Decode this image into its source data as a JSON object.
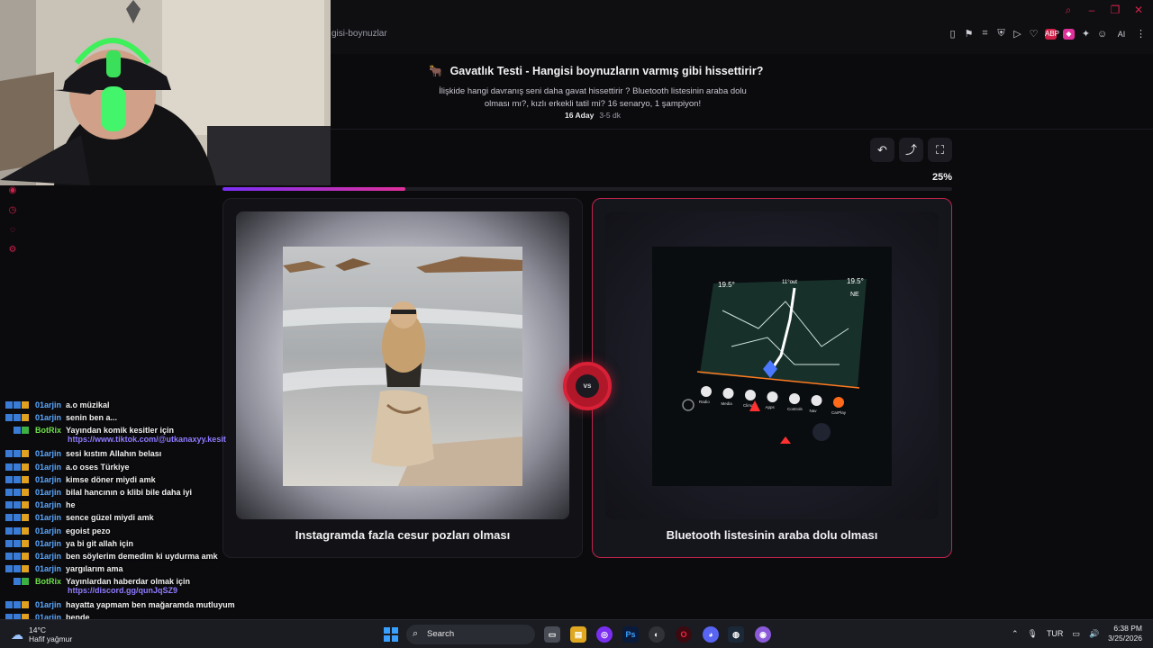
{
  "browser": {
    "url_fragment": "gisi-boynuzlar",
    "window_controls": [
      "search-icon",
      "minimize-icon",
      "restore-icon",
      "close-icon"
    ],
    "toolbar": {
      "ext_red_label": "ABP",
      "ai_label": "AI"
    }
  },
  "quiz": {
    "emoji": "🐂",
    "title": "Gavatlık Testi - Hangisi boynuzların varmış gibi hissettirir?",
    "description": "İlişkide hangi davranış seni daha gavat hissettirir ? Bluetooth listesinin araba dolu olması mı?, kızlı erkekli tatil mi? 16 senaryo, 1 şampiyon!",
    "candidates": "16 Aday",
    "duration": "3-5 dk",
    "progress_label": "25%",
    "progress_value": 0.25
  },
  "actions": {
    "back_icon": "↶",
    "share_icon": "⤴",
    "fullscreen_icon": "⛶"
  },
  "cards": {
    "left_caption": "Instagramda fazla cesur pozları olması",
    "right_caption": "Bluetooth listesinin araba dolu olması",
    "vs_label": "vs"
  },
  "car_screen": {
    "temp_left": "19.5°",
    "time": "11°out",
    "temp_right": "19.5°",
    "compass": "NE",
    "buttons": [
      "Radio",
      "Media",
      "Climate",
      "Apps",
      "Controls",
      "Nav",
      "CarPlay"
    ]
  },
  "chat": [
    {
      "user": "01arjin",
      "msg": "a.o müzikal",
      "bot": false
    },
    {
      "user": "01arjin",
      "msg": "senin ben a...",
      "bot": false
    },
    {
      "user": "BotRix",
      "msg": "Yayından komik kesitler için",
      "link": "https://www.tiktok.com/@utkanaxyy.kesit",
      "bot": true
    },
    {
      "user": "01arjin",
      "msg": "sesi kıstım Allahın belası",
      "bot": false
    },
    {
      "user": "01arjin",
      "msg": "a.o oses Türkiye",
      "bot": false
    },
    {
      "user": "01arjin",
      "msg": "kimse döner miydi amk",
      "bot": false
    },
    {
      "user": "01arjin",
      "msg": "bilal hancının o klibi bile daha iyi",
      "bot": false
    },
    {
      "user": "01arjin",
      "msg": "he",
      "bot": false
    },
    {
      "user": "01arjin",
      "msg": "sence güzel miydi amk",
      "bot": false
    },
    {
      "user": "01arjin",
      "msg": "egoist pezo",
      "bot": false
    },
    {
      "user": "01arjin",
      "msg": "ya bi git allah için",
      "bot": false
    },
    {
      "user": "01arjin",
      "msg": "ben söylerim demedim ki uydurma amk",
      "bot": false
    },
    {
      "user": "01arjin",
      "msg": "yargılarım ama",
      "bot": false
    },
    {
      "user": "BotRix",
      "msg": "Yayınlardan haberdar olmak için",
      "link": "https://discord.gg/qunJqSZ9",
      "bot": true
    },
    {
      "user": "01arjin",
      "msg": "hayatta yapmam ben mağaramda mutluyum",
      "bot": false
    },
    {
      "user": "01arjin",
      "msg": "bende",
      "bot": false
    }
  ],
  "taskbar": {
    "weather_temp": "14°C",
    "weather_desc": "Hafif yağmur",
    "search_placeholder": "Search",
    "language": "TUR",
    "time": "6:38 PM",
    "date": "3/25/2026"
  }
}
